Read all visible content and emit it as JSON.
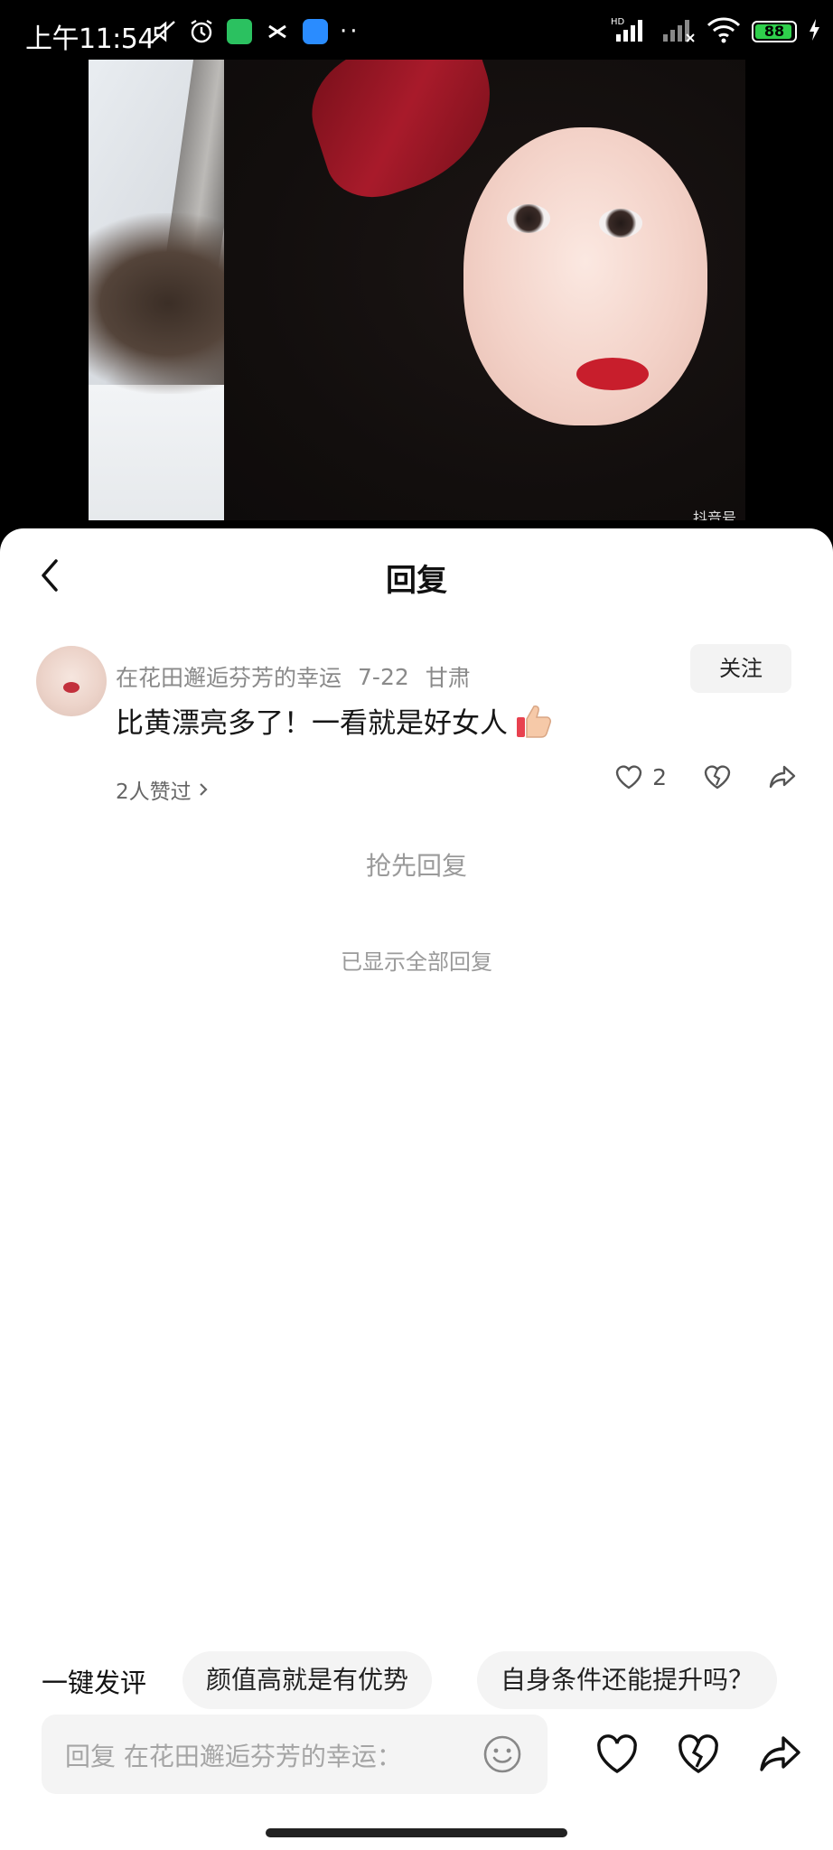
{
  "status_bar": {
    "time": "上午11:54",
    "battery": "88",
    "network": "HD"
  },
  "video": {
    "watermark": "抖音号"
  },
  "header": {
    "title": "回复"
  },
  "comment": {
    "username": "在花田邂逅芬芳的幸运",
    "date": "7-22",
    "location": "甘肃",
    "follow_label": "关注",
    "text": "比黄漂亮多了！一看就是好女人",
    "liked_by": "2人赞过",
    "like_count": "2"
  },
  "first_reply_label": "抢先回复",
  "all_shown_label": "已显示全部回复",
  "quick_comments": {
    "label": "一键发评",
    "chips": [
      "颜值高就是有优势",
      "自身条件还能提升吗？"
    ]
  },
  "input": {
    "placeholder": "回复 在花田邂逅芬芳的幸运："
  }
}
